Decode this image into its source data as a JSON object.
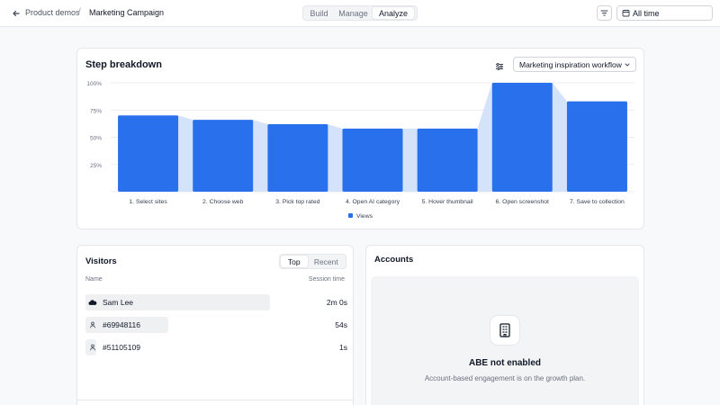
{
  "breadcrumb": {
    "back_icon": "arrow-left-icon",
    "parent": "Product demos",
    "separator": "/",
    "current": "Marketing Campaign"
  },
  "mode_tabs": [
    {
      "label": "Build",
      "active": false
    },
    {
      "label": "Manage",
      "active": false
    },
    {
      "label": "Analyze",
      "active": true
    }
  ],
  "toolbar": {
    "filter_icon": "filter-lines-icon",
    "date_icon": "calendar-icon",
    "date_label": "All time"
  },
  "step_breakdown": {
    "title": "Step breakdown",
    "settings_icon": "sliders-icon",
    "workflow_select": "Marketing inspiration workflow"
  },
  "chart_data": {
    "type": "bar",
    "categories": [
      "1. Select sites",
      "2. Choose web",
      "3. Pick top rated",
      "4. Open AI category",
      "5. Hover thumbnail",
      "6. Open screenshot",
      "7. Save to collection"
    ],
    "series": [
      {
        "name": "Views",
        "values": [
          70,
          66,
          62,
          58,
          58,
          100,
          83
        ]
      }
    ],
    "y_ticks": [
      "100%",
      "75%",
      "50%",
      "25%"
    ],
    "ylim": [
      0,
      100
    ],
    "legend": "bottom",
    "colors": {
      "bar": "#2970ec",
      "funnel": "#d4e2fa"
    }
  },
  "visitors": {
    "title": "Visitors",
    "tabs": [
      {
        "label": "Top",
        "active": true
      },
      {
        "label": "Recent",
        "active": false
      }
    ],
    "col_name": "Name",
    "col_session": "Session time",
    "rows": [
      {
        "name": "Sam Lee",
        "session": "2m 0s",
        "share": 1.0,
        "icon": "cloud-avatar-icon"
      },
      {
        "name": "#69948116",
        "session": "54s",
        "share": 0.45,
        "icon": "user-icon"
      },
      {
        "name": "#51105109",
        "session": "1s",
        "share": 0.06,
        "icon": "user-icon"
      }
    ]
  },
  "accounts": {
    "title": "Accounts",
    "icon": "building-icon",
    "heading": "ABE not enabled",
    "subtext": "Account-based engagement is on the growth plan."
  }
}
